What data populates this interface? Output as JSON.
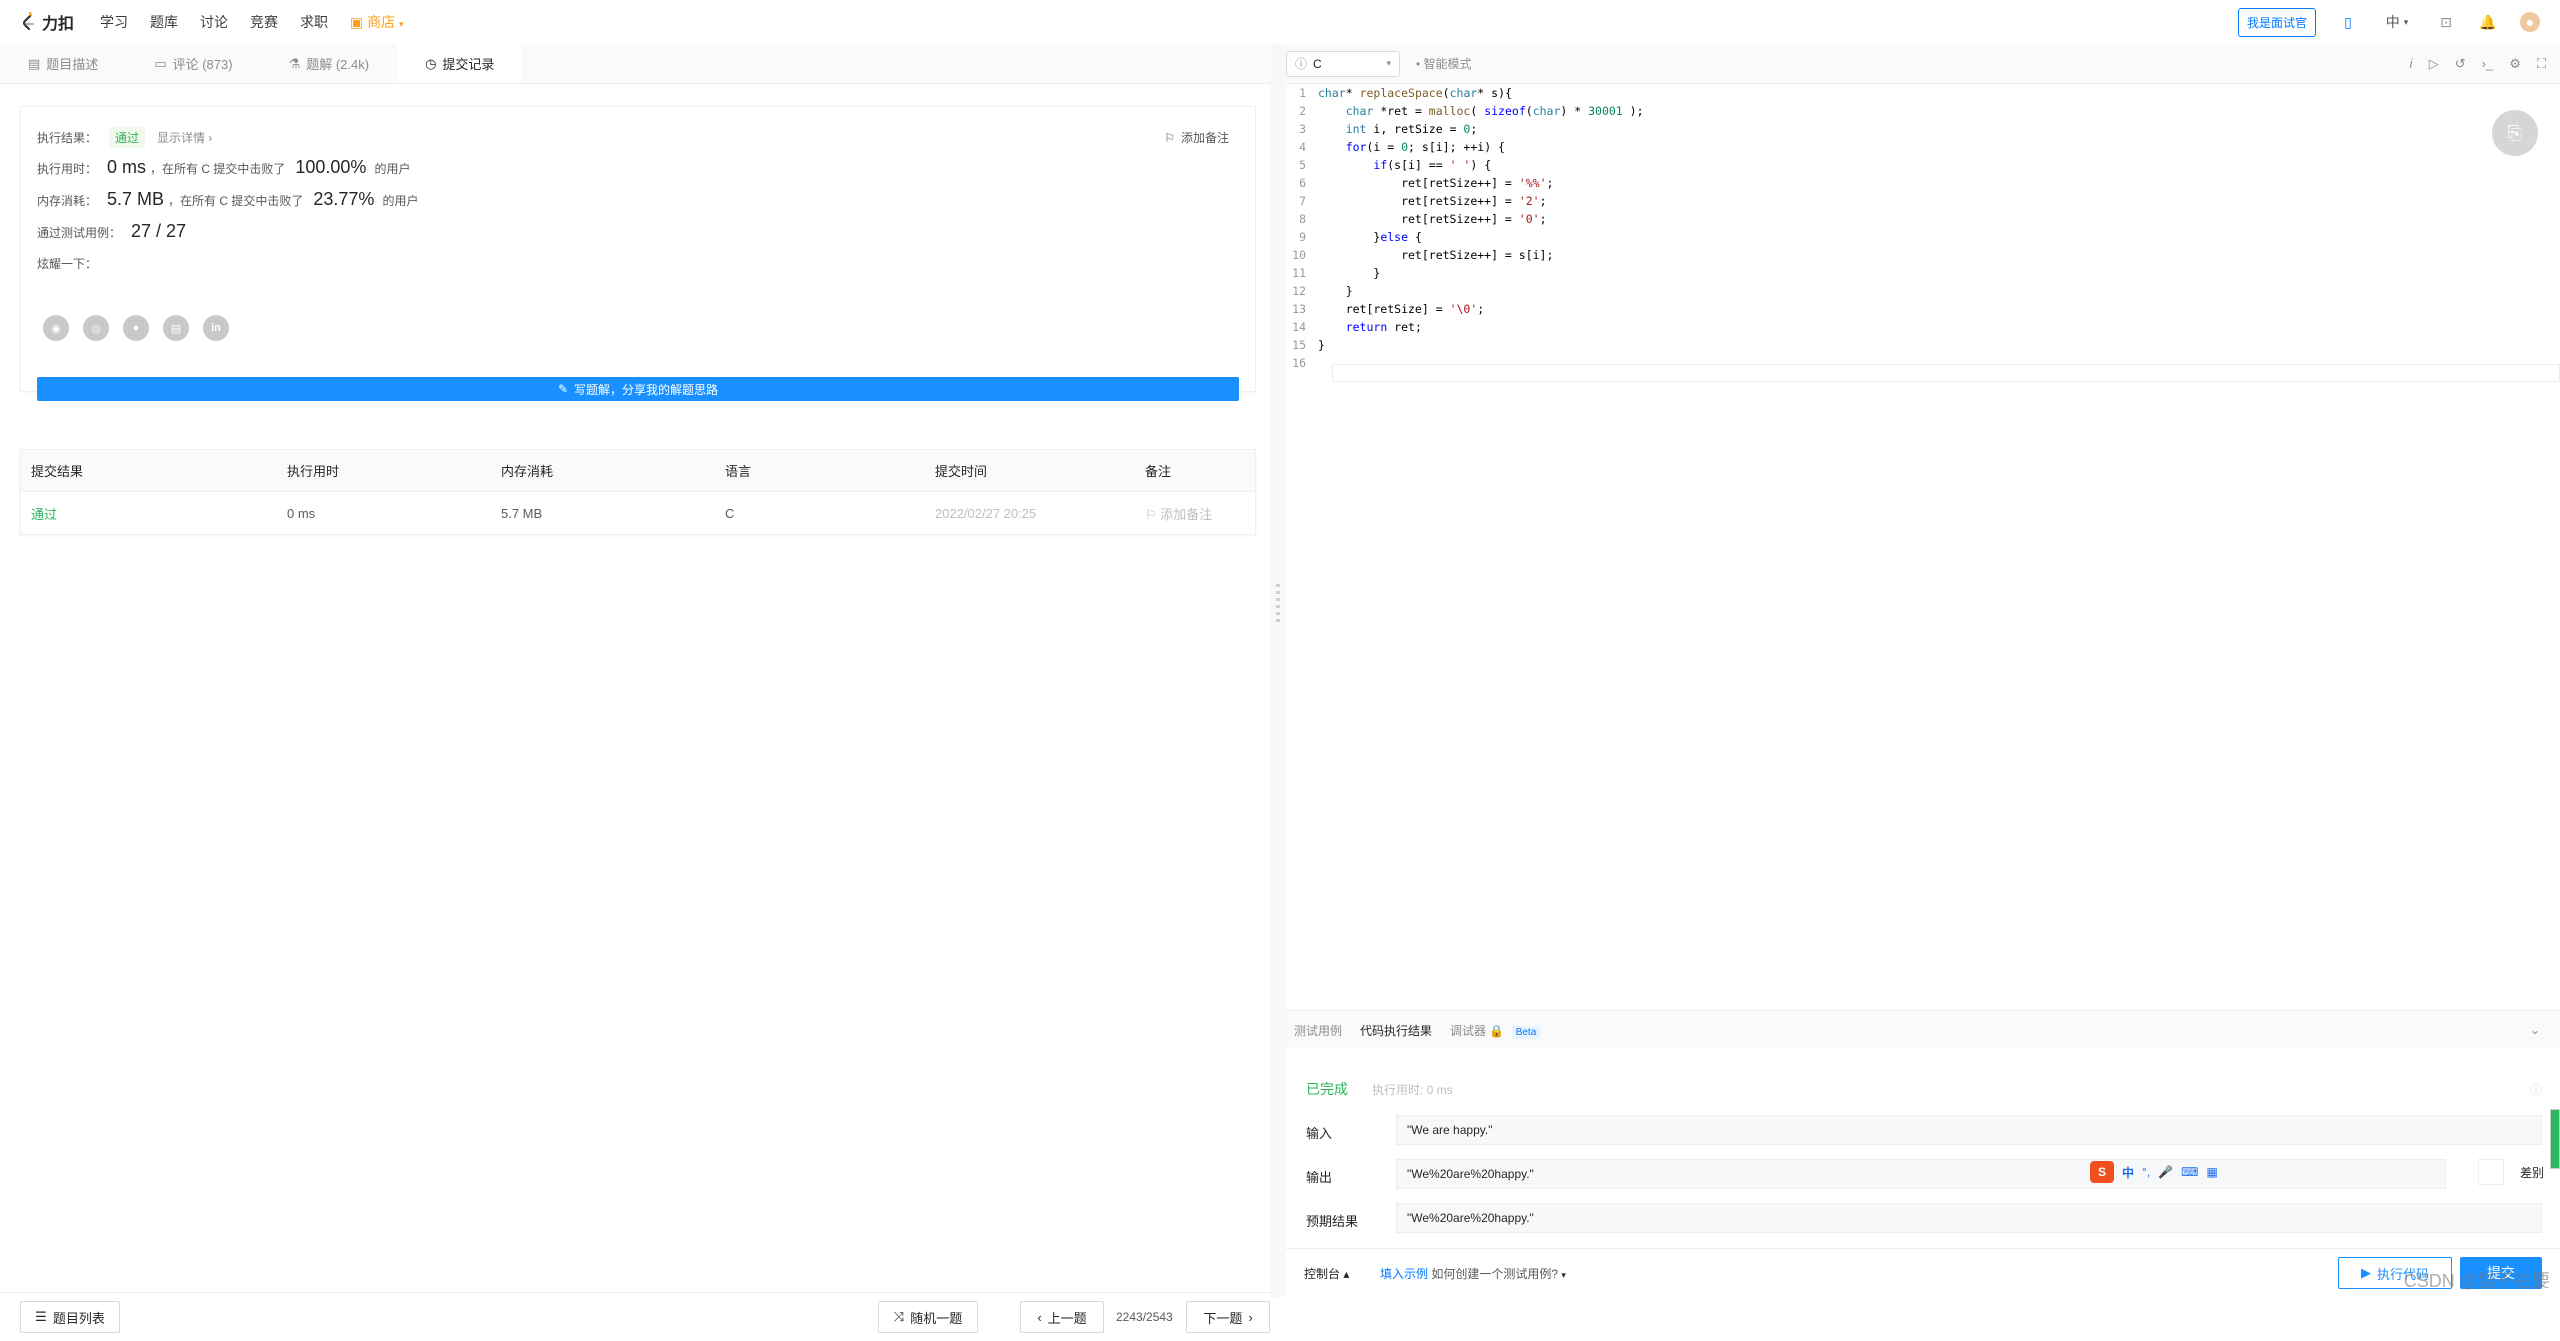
{
  "topnav": {
    "brand": "力扣",
    "items": [
      "学习",
      "题库",
      "讨论",
      "竞赛",
      "求职"
    ],
    "store": "商店",
    "interview_button": "我是面试官",
    "lang": "中"
  },
  "tabs": [
    {
      "label": "题目描述"
    },
    {
      "label": "评论 (873)"
    },
    {
      "label": "题解 (2.4k)"
    },
    {
      "label": "提交记录"
    }
  ],
  "result": {
    "result_label": "执行结果：",
    "status": "通过",
    "details": "显示详情 ›",
    "add_note": "添加备注",
    "time_label": "执行用时：",
    "time_value": "0 ms",
    "time_beat": "，在所有 C 提交中击败了",
    "time_pct": "100.00%",
    "users": "的用户",
    "mem_label": "内存消耗：",
    "mem_value": "5.7 MB",
    "mem_beat": "，在所有 C 提交中击败了",
    "mem_pct": "23.77%",
    "cases_label": "通过测试用例：",
    "cases_value": "27 / 27",
    "share_label": "炫耀一下：",
    "write_button": "写题解，分享我的解题思路"
  },
  "submissions": {
    "headers": [
      "提交结果",
      "执行用时",
      "内存消耗",
      "语言",
      "提交时间",
      "备注"
    ],
    "rows": [
      {
        "status": "通过",
        "time": "0 ms",
        "memory": "5.7 MB",
        "lang": "C",
        "submitted": "2022/02/27 20:25",
        "note": "添加备注"
      }
    ]
  },
  "leftbar": {
    "problem_list": "题目列表",
    "random": "随机一题",
    "prev": "上一题",
    "counter": "2243/2543",
    "next": "下一题"
  },
  "editor": {
    "language": "C",
    "smart_mode": "智能模式",
    "code_lines": [
      "char* replaceSpace(char* s){",
      "    char *ret = malloc( sizeof(char) * 30001 );",
      "    int i, retSize = 0;",
      "    for(i = 0; s[i]; ++i) {",
      "        if(s[i] == ' ') {",
      "            ret[retSize++] = '%%';",
      "            ret[retSize++] = '2';",
      "            ret[retSize++] = '0';",
      "        }else {",
      "            ret[retSize++] = s[i];",
      "        }",
      "    }",
      "    ret[retSize] = '\\0';",
      "    return ret;",
      "}",
      ""
    ]
  },
  "console": {
    "tabs": [
      "测试用例",
      "代码执行结果",
      "调试器"
    ],
    "beta": "Beta",
    "status": "已完成",
    "time": "执行用时: 0 ms",
    "input_label": "输入",
    "input_value": "\"We are happy.\"",
    "output_label": "输出",
    "output_value": "\"We%20are%20happy.\"",
    "expected_label": "预期结果",
    "expected_value": "\"We%20are%20happy.\"",
    "diff_label": "差别",
    "ime_logo": "S",
    "ime_lang": "中"
  },
  "rightbar": {
    "console_toggle": "控制台 ▴",
    "example_link": "填入示例",
    "create_case": "如何创建一个测试用例?",
    "run": "执行代码",
    "submit": "提交",
    "watermark": "CSDN @猫不在要"
  }
}
